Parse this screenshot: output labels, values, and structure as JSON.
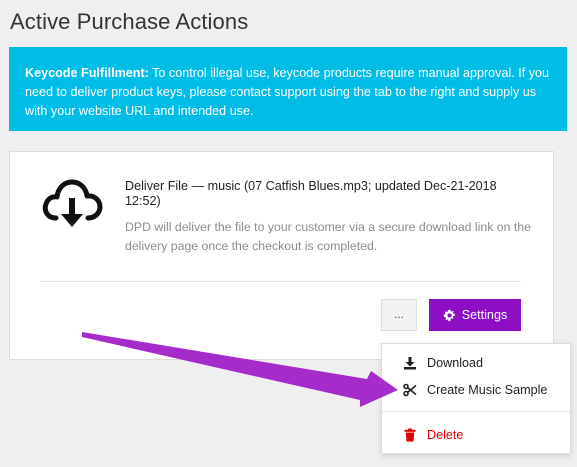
{
  "page": {
    "title": "Active Purchase Actions"
  },
  "notice": {
    "bold_label": "Keycode Fulfillment:",
    "text": " To control illegal use, keycode products require manual approval. If you need to deliver product keys, please contact support using the tab to the right and supply us with your website URL and intended use."
  },
  "action": {
    "icon": "cloud-download-icon",
    "title": "Deliver File — music (07 Catfish Blues.mp3; updated Dec-21-2018 12:52)",
    "description": "DPD will deliver the file to your customer via a secure download link on the delivery page once the checkout is completed."
  },
  "buttons": {
    "more_label": "...",
    "settings_label": "Settings",
    "settings_color": "#8e0fc3"
  },
  "menu": {
    "items": [
      {
        "label": "Download",
        "icon": "download-icon"
      },
      {
        "label": "Create Music Sample",
        "icon": "scissors-icon"
      },
      {
        "label": "Delete",
        "icon": "trash-icon",
        "color": "#e60000"
      }
    ]
  },
  "colors": {
    "notice_bg": "#00bde8",
    "arrow": "#a020c8"
  }
}
